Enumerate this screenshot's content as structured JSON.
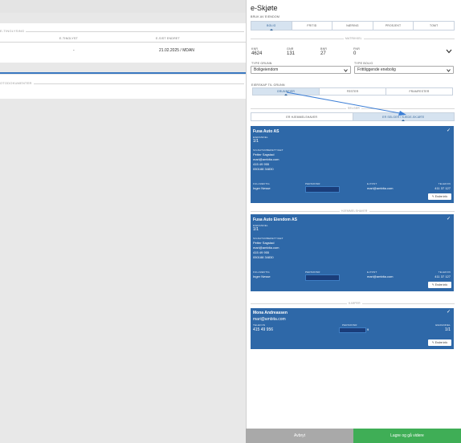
{
  "left": {
    "tinglysing_title": "E-TINGLYSING",
    "col_etinglyst": "E-TINGLYST",
    "col_sist_endret": "E-SIST ENDRET",
    "etinglyst_value": "-",
    "sist_endret_value": "21.02.2025 / MDAN",
    "dokumenter_title": "OTODOKUMENTER"
  },
  "panel": {
    "title": "e-Skjøte",
    "bruk_label": "BRUK AV EIENDOM",
    "bruk_tabs": [
      "BOLIG",
      "FRITID",
      "NÆRING",
      "PROSJEKT",
      "TOMT"
    ],
    "bruk_active": 0,
    "matrikkel_label": "MATRIKKEL",
    "matrikkel": [
      {
        "label": "KNR",
        "value": "4624"
      },
      {
        "label": "GNR",
        "value": "131"
      },
      {
        "label": "BNR",
        "value": "27"
      },
      {
        "label": "FNR",
        "value": "0"
      }
    ],
    "type_grunn_label": "TYPE GRUNN",
    "type_grunn_value": "Boligeiendom",
    "type_bolig_label": "TYPE BOLIG",
    "type_bolig_value": "Frittliggende enebolig",
    "eierskap_label": "EIERSKAP TIL GRUNN",
    "eierskap_tabs": [
      "GRUNNEIER",
      "FESTER",
      "FRAMFESTER"
    ],
    "eierskap_active": 0,
    "selger_label": "SELGER",
    "selger_tabs": [
      "ER HJEMMELSHAVER",
      "ER SELGER I KJEDE-SKJØTE"
    ],
    "selger_active": 1,
    "hjemmelshaver_label": "HJEMMELSHAVER",
    "kjoper_label": "KJØPER",
    "cards": [
      {
        "name": "Fusa Auto AS",
        "eierandel_label": "EIERANDEL",
        "eierandel": "1/1",
        "signatur_label": "SIGNATURBERETTIGET",
        "signatur_lines": [
          "Petter Sagstad",
          "mari@ambita.com",
          "415 49 955",
          "050188 34830"
        ],
        "fullmektig_label": "FULLMEKTIG",
        "fullmektig": "Inger Nesse",
        "personnr_label": "PERSONNR",
        "epost_label": "E-POST",
        "epost": "mari@ambita.com",
        "telefon_label": "TELEFON",
        "telefon": "411 37 127",
        "endre": "Endre info"
      },
      {
        "name": "Fusa Auto Eiendom AS",
        "eierandel_label": "EIERANDEL",
        "eierandel": "1/1",
        "signatur_label": "SIGNATURBERETTIGET",
        "signatur_lines": [
          "Petter Sagstad",
          "mari@ambita.com",
          "415 49 955",
          "050188 34830"
        ],
        "fullmektig_label": "FULLMEKTIG",
        "fullmektig": "Inger Nesse",
        "personnr_label": "PERSONNR",
        "epost_label": "E-POST",
        "epost": "mari@ambita.com",
        "telefon_label": "TELEFON",
        "telefon": "411 37 127",
        "endre": "Endre info"
      }
    ],
    "buyer": {
      "name": "Mona Andreassen",
      "email": "mari@ambita.com",
      "telefon_label": "TELEFON",
      "telefon": "415 49 956",
      "personnr_label": "PERSONNR",
      "personnr_suffix": "9",
      "eierandel_label": "EIERANDEL",
      "eierandel": "1/1",
      "endre": "Endre info"
    },
    "cancel_label": "Avbryt",
    "save_label": "Lagre og gå videre"
  },
  "colors": {
    "card_blue": "#2e68a8",
    "save_green": "#3fae56",
    "cancel_gray": "#a9a9a9",
    "tab_active_bg": "#d6e3f0",
    "arrow_blue": "#3d7fd6"
  }
}
